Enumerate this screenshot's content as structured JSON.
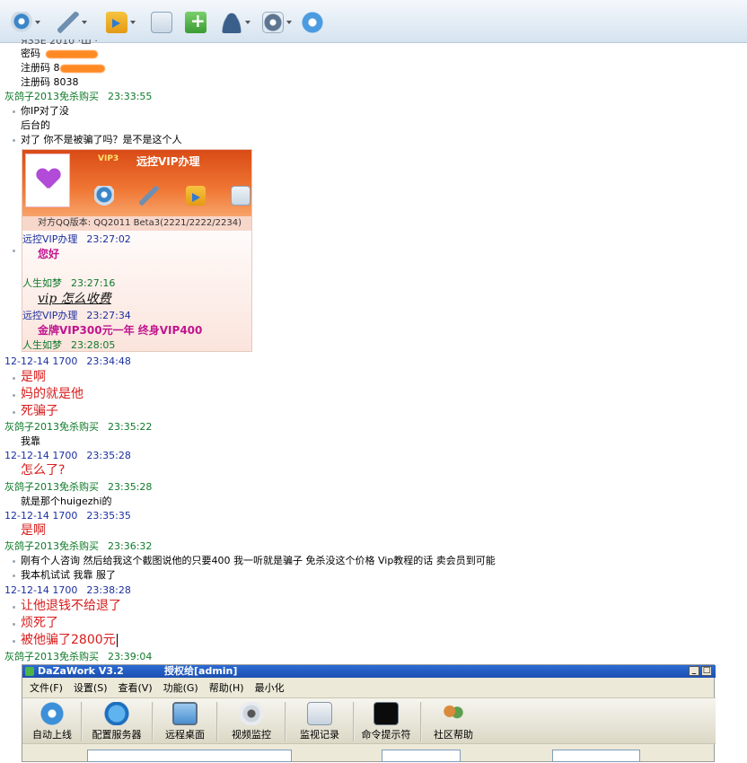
{
  "toolbar": {
    "icons": [
      "camera-icon",
      "microphone-icon",
      "folder-transfer-icon",
      "mail-icon",
      "add-contact-icon",
      "user-icon",
      "settings-icon",
      "share-icon"
    ]
  },
  "chat": {
    "partial_top": "ЯЗ5Е 2010 ·Ш ·",
    "password_label": "密码",
    "reg1_label": "注册码",
    "reg1_value": "8",
    "reg2": "注册码 8038",
    "msgs": [
      {
        "sender": "灰鸽子2013免杀购买",
        "time": "23:33:55"
      },
      {
        "text1": "你IP对了没",
        "text2": "后台的",
        "text3": "对了 你不是被骗了吗？是不是这个人"
      }
    ],
    "embedded": {
      "vip_badge": "VIP3",
      "title": "远控VIP办理",
      "version": "对方QQ版本: QQ2011 Beta3(2221/2222/2234)",
      "h1_name": "远控VIP办理",
      "h1_time": "23:27:02",
      "m1": "您好",
      "h2_name": "人生如梦",
      "h2_time": "23:27:16",
      "m2": "vip 怎么收费",
      "h3_name": "远控VIP办理",
      "h3_time": "23:27:34",
      "m3": "金牌VIP300元一年 终身VIP400",
      "h4_name": "人生如梦",
      "h4_time": "23:28:05"
    },
    "h_a_name": "12-12-14 1700",
    "h_a_time": "23:34:48",
    "a1": "是啊",
    "a2": "妈的就是他",
    "a3": "死骗子",
    "h_b_name": "灰鸽子2013免杀购买",
    "h_b_time": "23:35:22",
    "b1": "我靠",
    "h_c_name": "12-12-14 1700",
    "h_c_time": "23:35:28",
    "c1": "怎么了?",
    "h_d_name": "灰鸽子2013免杀购买",
    "h_d_time": "23:35:28",
    "d1": "就是那个huigezhi的",
    "h_e_name": "12-12-14 1700",
    "h_e_time": "23:35:35",
    "e1": "是啊",
    "h_f_name": "灰鸽子2013免杀购买",
    "h_f_time": "23:36:32",
    "f1": "刚有个人咨询 然后给我这个截图说他的只要400 我一听就是骗子 免杀没这个价格 Vip教程的话 卖会员到可能",
    "f2": "我本机试试 我靠 服了",
    "h_g_name": "12-12-14 1700",
    "h_g_time": "23:38:28",
    "g1": "让他退钱不给退了",
    "g2": "烦死了",
    "g3": "被他骗了2800元",
    "h_h_name": "灰鸽子2013免杀购买",
    "h_h_time": "23:39:04"
  },
  "dazawork": {
    "app_name": "DaZaWork V3.2",
    "auth": "授权给[admin]",
    "minimize_glyph": "_",
    "maximize_glyph": "□",
    "menu": [
      "文件(F)",
      "设置(S)",
      "查看(V)",
      "功能(G)",
      "帮助(H)",
      "最小化"
    ],
    "tools": [
      "自动上线",
      "配置服务器",
      "远程桌面",
      "视频监控",
      "监视记录",
      "命令提示符",
      "社区帮助"
    ]
  }
}
